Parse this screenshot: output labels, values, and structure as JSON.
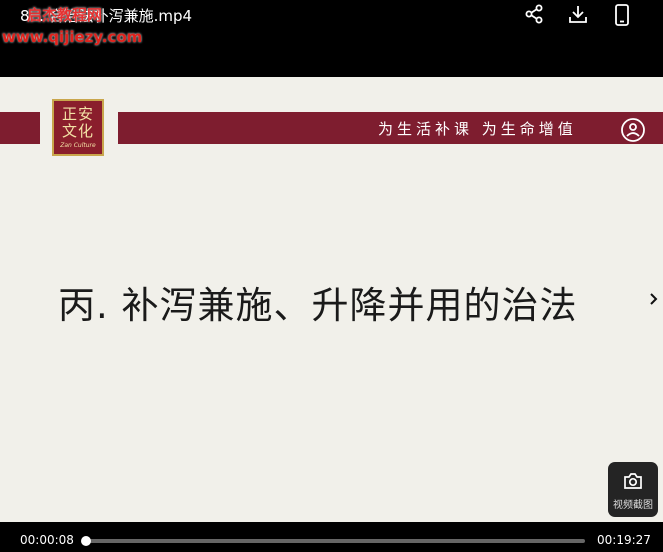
{
  "topbar": {
    "title": "8... 合治法补泻兼施.mp4",
    "watermark_name": "启杰教程网",
    "watermark_url": "www.qijiezy.com",
    "icons": [
      "share-icon",
      "download-icon",
      "phone-icon"
    ]
  },
  "slide": {
    "logo_line1": "正安",
    "logo_line2": "文化",
    "logo_sub": "Zan Culture",
    "slogan": "为生活补课  为生命增值",
    "heading": "丙. 补泻兼施、升降并用的治法",
    "band_color": "#7e1d2f",
    "logo_gold": "#c9a64c"
  },
  "screenshot_button": {
    "label": "视频截图"
  },
  "player": {
    "current_time": "00:00:08",
    "total_time": "00:19:27",
    "progress": 0.007
  }
}
